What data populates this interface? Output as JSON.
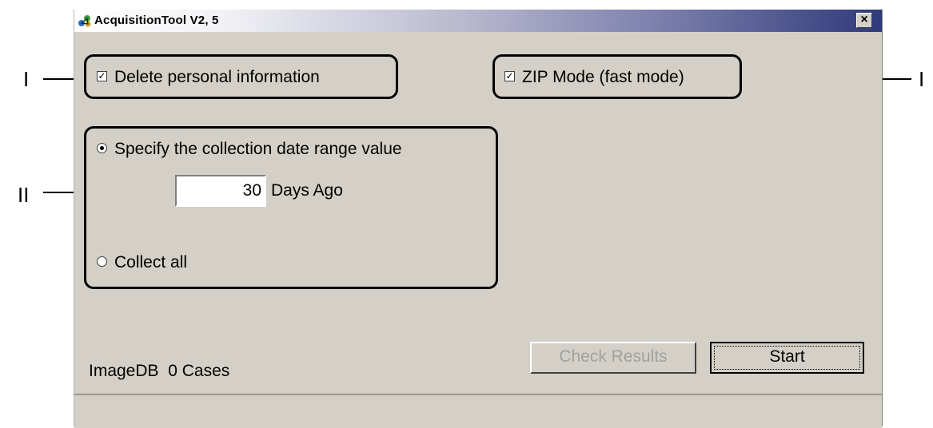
{
  "window": {
    "title": "AcquisitionTool V2, 5",
    "close_symbol": "×"
  },
  "options": {
    "delete_personal": {
      "label": "Delete personal information",
      "checked": true,
      "check_mark": "✓"
    },
    "zip_mode": {
      "label": "ZIP Mode (fast mode)",
      "checked": true,
      "check_mark": "✓"
    }
  },
  "date_range": {
    "specify_label": "Specify the collection date range value",
    "specify_selected": true,
    "days_value": "30",
    "days_unit": "Days Ago",
    "collect_all_label": "Collect all",
    "collect_all_selected": false
  },
  "status": {
    "imagedb_text": "ImageDB  0 Cases"
  },
  "buttons": {
    "check_results": "Check Results",
    "start": "Start"
  },
  "annotations": {
    "callout_one": "I",
    "callout_one_right": "I",
    "callout_two": "II"
  }
}
